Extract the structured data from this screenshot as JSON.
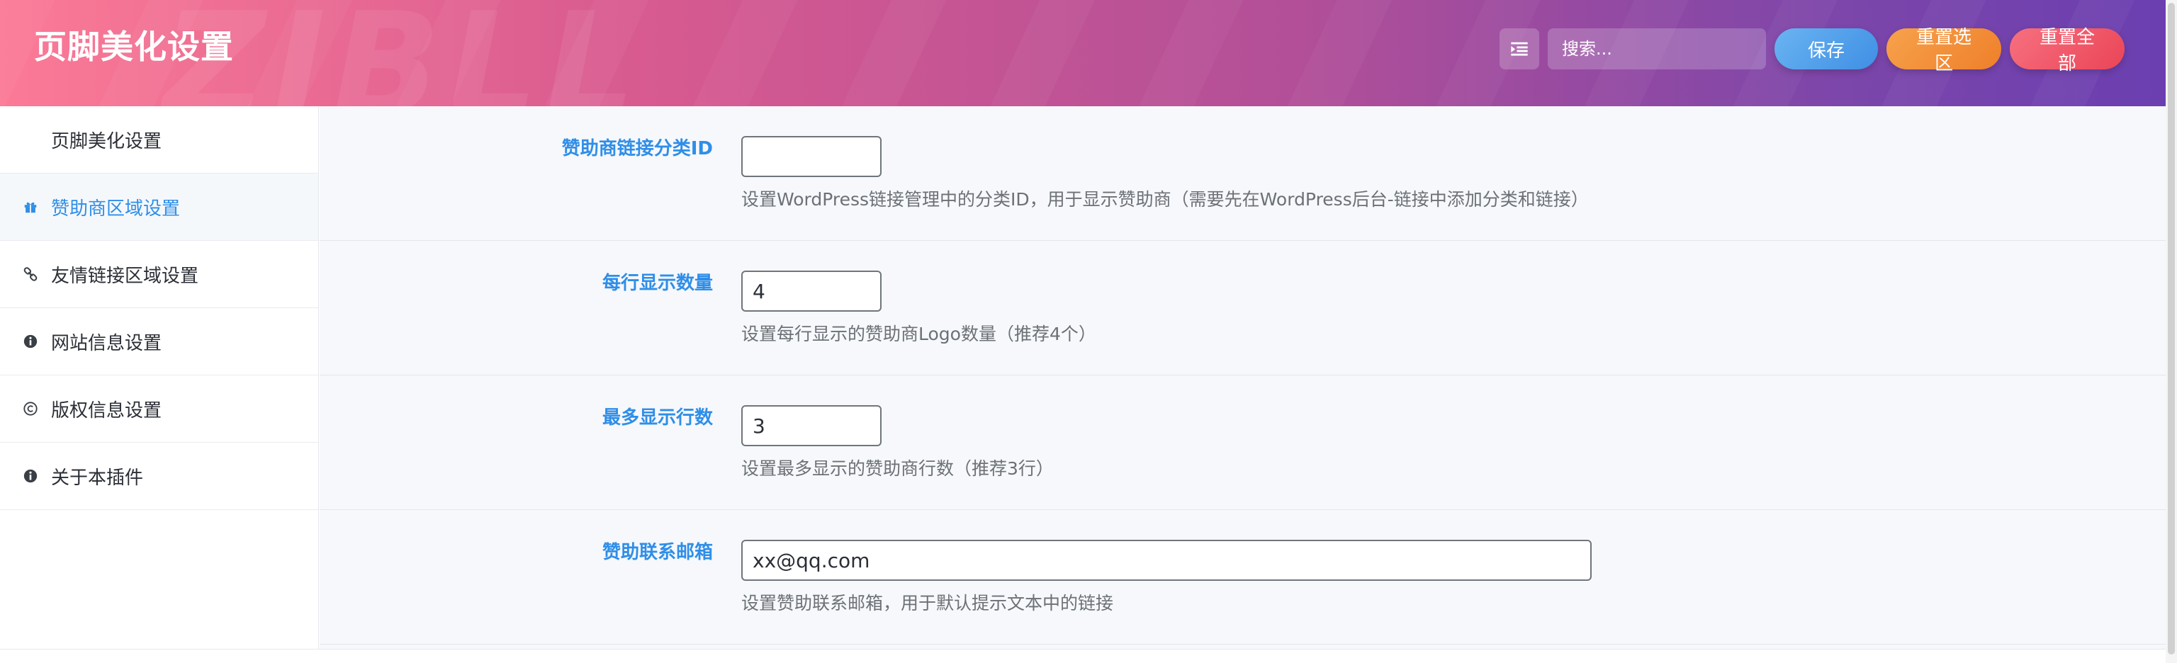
{
  "header": {
    "title": "页脚美化设置",
    "watermark": "ZIBLL",
    "expand_icon": "menu-expand-icon",
    "search_placeholder": "搜索...",
    "buttons": {
      "save": "保存",
      "reset_section": "重置选区",
      "reset_all": "重置全部"
    },
    "colors": {
      "gradient_start": "#fb7a96",
      "gradient_end": "#6b3fb0",
      "save": "#4a9be9",
      "reset_section": "#f18d38",
      "reset_all": "#ee5667"
    }
  },
  "sidebar": {
    "items": [
      {
        "label": "页脚美化设置",
        "icon": "",
        "active": false
      },
      {
        "label": "赞助商区域设置",
        "icon": "gift-icon",
        "active": true
      },
      {
        "label": "友情链接区域设置",
        "icon": "link-icon",
        "active": false
      },
      {
        "label": "网站信息设置",
        "icon": "info-icon",
        "active": false
      },
      {
        "label": "版权信息设置",
        "icon": "copyright-icon",
        "active": false
      },
      {
        "label": "关于本插件",
        "icon": "info-icon",
        "active": false
      }
    ],
    "active_color": "#2f8ee8"
  },
  "main": {
    "fields": [
      {
        "label": "赞助商链接分类ID",
        "value": "",
        "description": "设置WordPress链接管理中的分类ID，用于显示赞助商（需要先在WordPress后台-链接中添加分类和链接）"
      },
      {
        "label": "每行显示数量",
        "value": "4",
        "description": "设置每行显示的赞助商Logo数量（推荐4个）"
      },
      {
        "label": "最多显示行数",
        "value": "3",
        "description": "设置最多显示的赞助商行数（推荐3行）"
      },
      {
        "label": "赞助联系邮箱",
        "value": "xx@qq.com",
        "description": "设置赞助联系邮箱，用于默认提示文本中的链接"
      }
    ],
    "label_color": "#2f8ee8"
  }
}
